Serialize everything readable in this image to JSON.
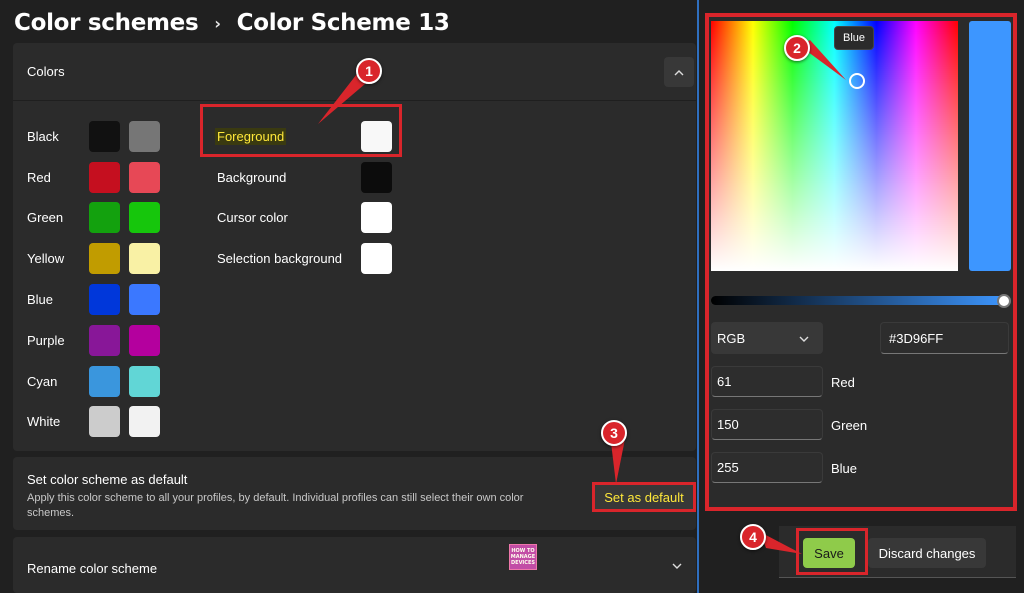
{
  "breadcrumb": {
    "parent": "Color schemes",
    "separator": "›",
    "current": "Color Scheme 13"
  },
  "colors_section": {
    "title": "Colors",
    "collapse_icon": "chevron-up-icon",
    "rows": [
      {
        "name": "Black",
        "dark": "#111111",
        "bright": "#767676"
      },
      {
        "name": "Red",
        "dark": "#C50F1F",
        "bright": "#E74856"
      },
      {
        "name": "Green",
        "dark": "#13A10E",
        "bright": "#16C60C"
      },
      {
        "name": "Yellow",
        "dark": "#C19C00",
        "bright": "#F9F1A5"
      },
      {
        "name": "Blue",
        "dark": "#0037DA",
        "bright": "#3B78FF"
      },
      {
        "name": "Purple",
        "dark": "#881798",
        "bright": "#B4009E"
      },
      {
        "name": "Cyan",
        "dark": "#3A96DD",
        "bright": "#61D6D6"
      },
      {
        "name": "White",
        "dark": "#CCCCCC",
        "bright": "#F2F2F2"
      }
    ],
    "properties": [
      {
        "name": "Foreground",
        "color": "#F8F8F8"
      },
      {
        "name": "Background",
        "color": "#0C0C0C"
      },
      {
        "name": "Cursor color",
        "color": "#FFFFFF"
      },
      {
        "name": "Selection background",
        "color": "#FFFFFF"
      }
    ]
  },
  "default_section": {
    "title": "Set color scheme as default",
    "description": "Apply this color scheme to all your profiles, by default. Individual profiles can still select their own color schemes.",
    "button": "Set as default"
  },
  "rename_section": {
    "title": "Rename color scheme",
    "chevron_icon": "chevron-down-icon",
    "logo_text": [
      "HOW TO",
      "MANAGE",
      "DEVICES"
    ]
  },
  "color_picker": {
    "tooltip": "Blue",
    "hue_fraction": 0.59,
    "saturation_fraction": 0.76,
    "value_fraction": 1.0,
    "selected_color": "#3D96FF",
    "mode": "RGB",
    "hex": "#3D96FF",
    "channels": [
      {
        "label": "Red",
        "value": "61"
      },
      {
        "label": "Green",
        "value": "150"
      },
      {
        "label": "Blue",
        "value": "255"
      }
    ]
  },
  "actions": {
    "save": "Save",
    "discard": "Discard changes"
  },
  "callouts": [
    "1",
    "2",
    "3",
    "4"
  ],
  "accent_colors": {
    "highlight_red": "#D9252B",
    "annotation_yellow": "#FFE83A",
    "save_green": "#8FCB4A"
  }
}
